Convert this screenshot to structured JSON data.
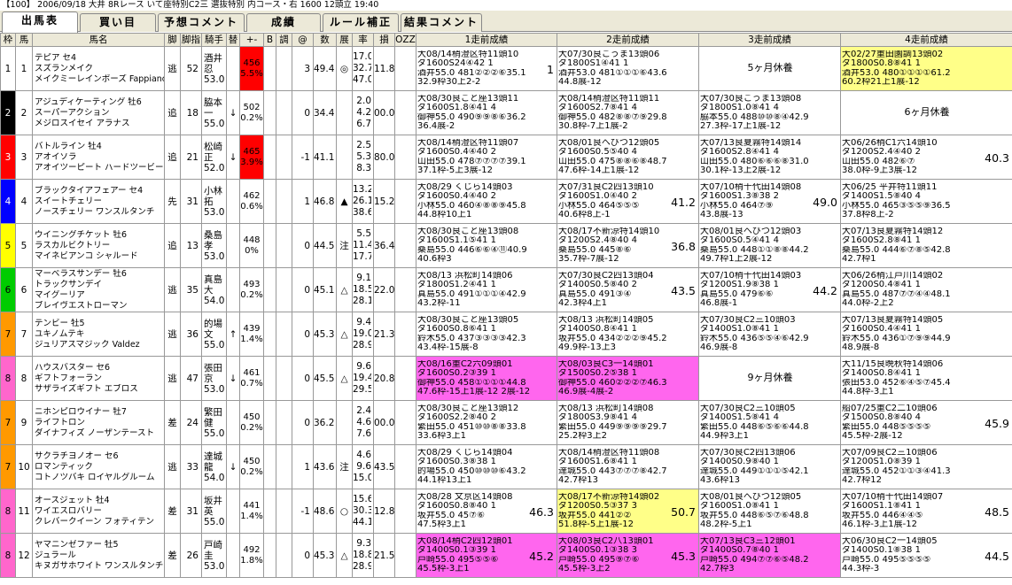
{
  "title": "【100】 2006/09/18 大井 8Rレース いて座特別C2三 選抜特別 内コース・右 1600 12頭立 19:40",
  "tabs": [
    "出馬表",
    "買い目",
    "予想コメント",
    "成績",
    "ルール補正",
    "結果コメント"
  ],
  "headers": [
    "枠",
    "馬",
    "馬名",
    "脚",
    "脚指",
    "騎手",
    "替",
    "+-",
    "B",
    "調",
    "@",
    "数",
    "展",
    "率",
    "損",
    "OZZ",
    "1走前成績",
    "2走前成績",
    "3走前成績",
    "4走前成績"
  ],
  "frame_colors": {
    "1": "#ffffff",
    "2": "#000000",
    "3": "#ff0000",
    "4": "#0000ff",
    "5": "#ffff00",
    "6": "#00cc00",
    "7": "#ff9900",
    "8": "#ff66cc"
  },
  "horses": [
    {
      "waku": "1",
      "uma": "1",
      "name": [
        "テピア セ4",
        "スズランメイク",
        "メイクミーレインボーズ Fappiano"
      ],
      "style": "逃",
      "idx": "52",
      "jockey": [
        "酒井",
        "忍",
        "53.0"
      ],
      "change": "",
      "weight": [
        "456",
        "5.5%"
      ],
      "wred": true,
      "chou": "",
      "at": "3",
      "num": "49.4",
      "ten": "◎",
      "odds": [
        "17.0",
        "32.7",
        "47.0"
      ],
      "loss": "11.8",
      "r1": {
        "bg": "",
        "lines": [
          "大08/14稍澄区特11頭10",
          "ダ1600S24④42 1",
          "酒井55.0 481②②②⑥35.1",
          "32.9枠30上2-2"
        ],
        "score": "1"
      },
      "r2": {
        "bg": "",
        "lines": [
          "大07/30良こうま13頭06",
          "ダ1800S1④41 1",
          "酒井53.0 481①①①⑥43.6",
          "44.8展-12"
        ],
        "score": ""
      },
      "r3": {
        "bg": "rest",
        "text": "5ヶ月休養"
      },
      "r4": {
        "bg": "yellow",
        "lines": [
          "大02/27重田園調13頭02",
          "ダ1800S0.8⑧41 1",
          "酒井53.0 480①①①①61.2",
          "60.2枠21上1展-12"
        ],
        "score": ""
      }
    },
    {
      "waku": "2",
      "uma": "2",
      "name": [
        "アジュディケーティング 牡6",
        "スーパーアクション",
        "メジロスイセイ アラナス"
      ],
      "style": "追",
      "idx": "18",
      "jockey": [
        "脇本",
        "一",
        "55.0"
      ],
      "change": "↓",
      "weight": [
        "502",
        "0.2%"
      ],
      "wred": false,
      "chou": "",
      "at": "0",
      "num": "34.4",
      "ten": "",
      "odds": [
        "2.0",
        "4.2",
        "6.7"
      ],
      "loss": "00.0",
      "r1": {
        "bg": "",
        "lines": [
          "大08/30良こと座13頭11",
          "ダ1600S1.8④41 4",
          "御神55.0 490⑨⑨⑧⑥36.2",
          "36.4展-2"
        ],
        "score": ""
      },
      "r2": {
        "bg": "",
        "lines": [
          "大08/14稍澄区特11頭11",
          "ダ1600S2.7⑧41 4",
          "御神55.0 482⑧⑧⑦⑨29.8",
          "30.8枠-7上1展-2"
        ],
        "score": ""
      },
      "r3": {
        "bg": "",
        "lines": [
          "大07/30良こうま13頭08",
          "ダ1800S1.0⑧41 4",
          "脇本55.0 488⑩⑩⑧④42.9",
          "27.3枠-17上1展-12"
        ],
        "score": ""
      },
      "r4": {
        "bg": "rest",
        "text": "6ヶ月休養"
      }
    },
    {
      "waku": "3",
      "uma": "3",
      "name": [
        "バトルライン 牡4",
        "アオイソラ",
        "アオイツーピート ハードツービート"
      ],
      "style": "追",
      "idx": "21",
      "jockey": [
        "松崎",
        "正",
        "52.0"
      ],
      "change": "↓",
      "weight": [
        "465",
        "3.9%"
      ],
      "wred": true,
      "chou": "",
      "at": "-1",
      "num": "41.1",
      "ten": "",
      "odds": [
        "2.5",
        "5.3",
        "8.3"
      ],
      "loss": "80.0",
      "r1": {
        "bg": "",
        "lines": [
          "大08/14稍澄区特11頭07",
          "ダ1600S0.4④40 2",
          "山田55.0 478⑦⑦⑦⑦39.1",
          "37.1枠-5上3展-12"
        ],
        "score": ""
      },
      "r2": {
        "bg": "",
        "lines": [
          "大08/01良へびつ12頭05",
          "ダ1600S0.5⑤40 4",
          "山田55.0 475⑧⑧⑥⑧48.7",
          "47.6枠-14上1展-12"
        ],
        "score": ""
      },
      "r3": {
        "bg": "",
        "lines": [
          "大07/13良夏霧特14頭14",
          "ダ1600S2.8④41 4",
          "山田55.0 480⑥⑥⑥⑧31.0",
          "30.1枠-13上2展-12"
        ],
        "score": ""
      },
      "r4": {
        "bg": "",
        "lines": [
          "大06/26稍C1六14頭10",
          "ダ1200S2.4④40 2",
          "山田55.0 482⑥⑦",
          "38.0枠-9上3展-12"
        ],
        "score": "40.3"
      }
    },
    {
      "waku": "4",
      "uma": "4",
      "name": [
        "ブラックタイアフェアー セ4",
        "スイートチェリー",
        "ノースチェリー ワンスルタンチ"
      ],
      "style": "先",
      "idx": "31",
      "jockey": [
        "小林",
        "拓",
        "53.0"
      ],
      "change": "",
      "weight": [
        "462",
        "0.6%"
      ],
      "wred": false,
      "chou": "",
      "at": "1",
      "num": "46.8",
      "ten": "▲",
      "odds": [
        "13.2",
        "26.1",
        "38.6"
      ],
      "loss": "15.2",
      "r1": {
        "bg": "",
        "lines": [
          "大08/29 くじら14頭03",
          "ダ1600S0.4④40 2",
          "小林55.0 460④⑧⑧⑨45.8",
          "44.8枠10上1"
        ],
        "score": ""
      },
      "r2": {
        "bg": "",
        "lines": [
          "大07/31良C2四13頭10",
          "ダ1600S1.0④40 2",
          "小林55.0 464⑤⑤⑤",
          "40.6枠8上-1"
        ],
        "score": "41.2"
      },
      "r3": {
        "bg": "",
        "lines": [
          "大07/10稍千代田14頭08",
          "ダ1600S1.3⑧38 2",
          "小林55.0 464⑦⑨",
          "43.8展-13"
        ],
        "score": "49.0"
      },
      "r4": {
        "bg": "",
        "lines": [
          "大06/25 平井特11頭11",
          "ダ1400S1.5⑧40 4",
          "小林55.0 465③⑤⑤⑨36.5",
          "37.8枠8上-2"
        ],
        "score": ""
      }
    },
    {
      "waku": "5",
      "uma": "5",
      "name": [
        "ウイニングチケット 牡6",
        "ラスカルビクトリー",
        "マイネビアンコ シャルード"
      ],
      "style": "追",
      "idx": "13",
      "jockey": [
        "桑島",
        "孝",
        "53.0"
      ],
      "change": "",
      "weight": [
        "448",
        "0%"
      ],
      "wred": false,
      "chou": "",
      "at": "0",
      "num": "44.5",
      "ten": "注",
      "odds": [
        "5.5",
        "11.4",
        "17.7"
      ],
      "loss": "36.4",
      "r1": {
        "bg": "",
        "lines": [
          "大08/30良こと座13頭08",
          "ダ1600S1.1⑤41 1",
          "桑島55.0 446⑥⑥④⑪40.9",
          "40.6枠3"
        ],
        "score": ""
      },
      "r2": {
        "bg": "",
        "lines": [
          "大08/17不新涼特14頭10",
          "ダ1200S2.4⑧40 4",
          "桑島55.0 445⑧⑥",
          "35.7枠-7展-12"
        ],
        "score": "36.8"
      },
      "r3": {
        "bg": "",
        "lines": [
          "大08/01良へびつ12頭03",
          "ダ1600S0.5④41 4",
          "桑島55.0 448①①⑧⑧44.2",
          "49.7枠1上2展-12"
        ],
        "score": ""
      },
      "r4": {
        "bg": "",
        "lines": [
          "大07/13良夏霧特14頭12",
          "ダ1600S2.8⑧41 1",
          "桑島55.0 444⑥⑦⑧⑤42.8",
          "42.7枠1"
        ],
        "score": ""
      }
    },
    {
      "waku": "6",
      "uma": "6",
      "name": [
        "マーベラスサンデー 牡6",
        "トラックサンデイ",
        "マイグーリア",
        "ブレイヴエストローマン"
      ],
      "style": "逃",
      "idx": "35",
      "jockey": [
        "真島",
        "大",
        "54.0"
      ],
      "change": "",
      "weight": [
        "493",
        "0.2%"
      ],
      "wred": false,
      "chou": "",
      "at": "0",
      "num": "45.1",
      "ten": "△",
      "odds": [
        "9.1",
        "18.5",
        "28.1"
      ],
      "loss": "22.0",
      "r1": {
        "bg": "",
        "lines": [
          "大08/13 浜松町14頭06",
          "ダ1800S1.2④41 1",
          "真島55.0 491①①①④42.9",
          "43.2枠-11"
        ],
        "score": ""
      },
      "r2": {
        "bg": "",
        "lines": [
          "大07/30良C2四13頭04",
          "ダ1400S0.5⑧40 2",
          "真島55.0 491③④",
          "42.3枠4上1"
        ],
        "score": "43.5"
      },
      "r3": {
        "bg": "",
        "lines": [
          "大07/10稍千代田14頭03",
          "ダ1200S1.9⑧38 1",
          "真島55.0 479⑥⑥",
          "46.8展-1"
        ],
        "score": "44.2"
      },
      "r4": {
        "bg": "",
        "lines": [
          "大06/26稍江戸川14頭02",
          "ダ1200S0.4⑧41 1",
          "真島55.0 487⑦⑦④④48.1",
          "44.0枠-2上2"
        ],
        "score": ""
      }
    },
    {
      "waku": "7",
      "uma": "7",
      "name": [
        "テンビー 牡5",
        "ユキノムテキ",
        "ジュリアスマジック Valdez"
      ],
      "style": "逃",
      "idx": "36",
      "jockey": [
        "的場",
        "文",
        "55.0"
      ],
      "change": "↑",
      "weight": [
        "439",
        "1.4%"
      ],
      "wred": false,
      "chou": "",
      "at": "0",
      "num": "45.3",
      "ten": "△",
      "odds": [
        "9.4",
        "19.0",
        "28.9"
      ],
      "loss": "21.3",
      "r1": {
        "bg": "",
        "lines": [
          "大08/30良こと座13頭05",
          "ダ1600S0.8⑥41 1",
          "鈴木55.0 437③③③③42.3",
          "43.4枠-15展-8"
        ],
        "score": ""
      },
      "r2": {
        "bg": "",
        "lines": [
          "大08/13 浜松町14頭05",
          "ダ1400S0.8④41 1",
          "坂井55.0 434②②②⑨45.2",
          "49.9枠-13上3"
        ],
        "score": ""
      },
      "r3": {
        "bg": "",
        "lines": [
          "大07/30良C2三10頭03",
          "ダ1400S1.0⑧41 1",
          "鈴木55.0 436⑤⑤④⑥42.9",
          "46.9展-8"
        ],
        "score": ""
      },
      "r4": {
        "bg": "",
        "lines": [
          "大07/13良夏霧特14頭05",
          "ダ1600S0.4④41 1",
          "鈴木55.0 436①⑦⑨⑨44.9",
          "48.9展-8"
        ],
        "score": ""
      }
    },
    {
      "waku": "8",
      "uma": "8",
      "name": [
        "ハウスバスター セ6",
        "ギフトフォーラン",
        "サザライズギフト エブロス"
      ],
      "style": "逃",
      "idx": "47",
      "jockey": [
        "張田",
        "京",
        "53.0"
      ],
      "change": "↓",
      "weight": [
        "461",
        "0.7%"
      ],
      "wred": false,
      "chou": "",
      "at": "0",
      "num": "45.5",
      "ten": "△",
      "odds": [
        "9.6",
        "19.4",
        "29.5"
      ],
      "loss": "20.8",
      "r1": {
        "bg": "pink",
        "lines": [
          "大08/16重C2六09頭01",
          "ダ1600S0.2③39 1",
          "御神55.0 458①①①①44.8",
          "47.6枠-15上1展-12 2展-12"
        ],
        "score": ""
      },
      "r2": {
        "bg": "pink",
        "lines": [
          "大08/03良C3一14頭01",
          "ダ1500S0.2⑤38 1",
          "御神55.0 460②②②⑦46.3",
          "46.9展-4展-2"
        ],
        "score": ""
      },
      "r3": {
        "bg": "rest",
        "text": "9ヶ月休養"
      },
      "r4": {
        "bg": "",
        "lines": [
          "大11/15良晩秋特14頭06",
          "ダ1400S0.8④41 1",
          "張田53.0 452⑥④⑤⑦45.4",
          "44.8枠-3上1"
        ],
        "score": ""
      }
    },
    {
      "waku": "7",
      "uma": "9",
      "name": [
        "ニホンピロウイナー 牡7",
        "ライフトロン",
        "ダイナフィズ ノーザンテースト"
      ],
      "style": "差",
      "idx": "24",
      "jockey": [
        "繁田",
        "健",
        "55.0"
      ],
      "change": "",
      "weight": [
        "450",
        "0.2%"
      ],
      "wred": false,
      "chou": "",
      "at": "0",
      "num": "36.2",
      "ten": "",
      "odds": [
        "2.4",
        "4.6",
        "7.6"
      ],
      "loss": "00.0",
      "r1": {
        "bg": "",
        "lines": [
          "大08/30良こと座13頭12",
          "ダ1600S2.2⑧40 2",
          "繁田55.0 451⑩⑩⑧⑧33.8",
          "33.6枠3上1"
        ],
        "score": ""
      },
      "r2": {
        "bg": "",
        "lines": [
          "大08/13 浜松町14頭08",
          "ダ1800S3.9⑧41 4",
          "繁田55.0 449⑨⑨⑨⑨29.7",
          "25.2枠3上2"
        ],
        "score": ""
      },
      "r3": {
        "bg": "",
        "lines": [
          "大07/30良C2三10頭05",
          "ダ1400S1.5⑧41 4",
          "繁田55.0 448⑥⑤⑥⑥44.8",
          "44.9枠3上1"
        ],
        "score": ""
      },
      "r4": {
        "bg": "",
        "lines": [
          "船07/25重C2二10頭06",
          "ダ1500S0.8⑧40 4",
          "繁田55.0 448⑤⑤⑤⑤",
          "45.5枠-2展-12"
        ],
        "score": "45.9"
      }
    },
    {
      "waku": "7",
      "uma": "10",
      "name": [
        "サクラチヨノオー セ6",
        "ロマンティック",
        "コトノツバキ ロイヤルグルーム"
      ],
      "style": "逃",
      "idx": "33",
      "jockey": [
        "達城",
        "龍",
        "54.0"
      ],
      "change": "↓",
      "weight": [
        "450",
        "0.2%"
      ],
      "wred": false,
      "chou": "",
      "at": "1",
      "num": "43.6",
      "ten": "注",
      "odds": [
        "4.6",
        "9.6",
        "15.0"
      ],
      "loss": "43.5",
      "r1": {
        "bg": "",
        "lines": [
          "大08/29 くじら14頭04",
          "ダ1600S0.3⑧38 1",
          "的場55.0 450⑩⑩⑩⑥43.2",
          "44.1枠13上1"
        ],
        "score": ""
      },
      "r2": {
        "bg": "",
        "lines": [
          "大08/14稍澄区特11頭08",
          "ダ1600S1.6⑧41 1",
          "達城55.0 443⑦⑦⑦⑧42.7",
          "42.7枠13"
        ],
        "score": ""
      },
      "r3": {
        "bg": "",
        "lines": [
          "大07/30良C2四13頭06",
          "ダ1400S0.9⑧40 1",
          "達城55.0 449①①①⑤42.1",
          "43.6枠13"
        ],
        "score": ""
      },
      "r4": {
        "bg": "",
        "lines": [
          "大07/09良C2三10頭06",
          "ダ1200S1.0⑧39 1",
          "達城55.0 452①①③④41.3",
          "42.7枠12"
        ],
        "score": ""
      }
    },
    {
      "waku": "8",
      "uma": "11",
      "name": [
        "オースジェット 牡4",
        "ワイエスロバリー",
        "クレバークイーン フォティテン"
      ],
      "style": "差",
      "idx": "31",
      "jockey": [
        "坂井",
        "英",
        "55.0"
      ],
      "change": "",
      "weight": [
        "441",
        "1.4%"
      ],
      "wred": false,
      "chou": "",
      "at": "-1",
      "num": "48.6",
      "ten": "○",
      "odds": [
        "15.6",
        "30.3",
        "44.1"
      ],
      "loss": "12.8",
      "r1": {
        "bg": "",
        "lines": [
          "大08/28 文京区14頭08",
          "ダ1600S0.8⑧40 1",
          "坂井55.0 45⑦⑥",
          "47.5枠3上1"
        ],
        "score": "46.3"
      },
      "r2": {
        "bg": "yellow",
        "lines": [
          "大08/17不新涼特14頭02",
          "ダ1200S0.5③37 3",
          "坂井55.0 441②②",
          "51.8枠-5上1展-12"
        ],
        "score": "50.7"
      },
      "r3": {
        "bg": "",
        "lines": [
          "大08/01良へびつ12頭05",
          "ダ1600S1.0⑧41 1",
          "坂井55.0 448⑥⑤⑦⑥48.8",
          "48.2枠-5上1"
        ],
        "score": ""
      },
      "r4": {
        "bg": "",
        "lines": [
          "大07/10稍千代田14頭07",
          "ダ1600S1.1⑧41 1",
          "坂井55.0 446④④⑤",
          "46.1枠-3上1展-12"
        ],
        "score": "48.5"
      }
    },
    {
      "waku": "8",
      "uma": "12",
      "name": [
        "ヤマニンゼファー 牡5",
        "ジュラール",
        "キヌガサホワイト ワンスルタンチ"
      ],
      "style": "差",
      "idx": "26",
      "jockey": [
        "戸崎",
        "圭",
        "53.0"
      ],
      "change": "",
      "weight": [
        "492",
        "1.8%"
      ],
      "wred": false,
      "chou": "",
      "at": "0",
      "num": "45.3",
      "ten": "△",
      "odds": [
        "9.3",
        "18.8",
        "28.9"
      ],
      "loss": "21.5",
      "r1": {
        "bg": "pink",
        "lines": [
          "大08/14稍C2四12頭01",
          "ダ1400S0.1③39 1",
          "戸崎55.0 495⑤⑤⑥",
          "45.5枠-3上1"
        ],
        "score": "45.2"
      },
      "r2": {
        "bg": "pink",
        "lines": [
          "大08/03良C2八13頭01",
          "ダ1400S0.1③38 3",
          "戸崎55.0 495⑨⑦⑥",
          "45.5枠-3上2"
        ],
        "score": "45.3"
      },
      "r3": {
        "bg": "pink",
        "lines": [
          "大07/13良C3三12頭01",
          "ダ1400S0.7⑧40 1",
          "戸崎55.0 494⑦⑦⑥⑤48.2",
          "42.7枠3"
        ],
        "score": ""
      },
      "r4": {
        "bg": "",
        "lines": [
          "大06/30良C2一14頭05",
          "ダ1400S0.1⑧38 1",
          "戸崎55.0 495⑤⑤⑤⑤",
          "44.3枠-3"
        ],
        "score": "44.5"
      }
    }
  ]
}
